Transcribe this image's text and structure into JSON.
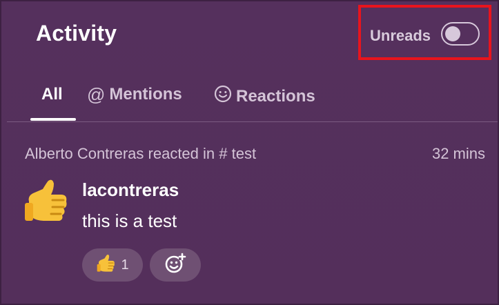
{
  "header": {
    "title": "Activity",
    "unreads_label": "Unreads",
    "unreads_enabled": false
  },
  "tabs": [
    {
      "label": "All",
      "icon": "",
      "active": true
    },
    {
      "label": "Mentions",
      "icon": "at-icon",
      "active": false
    },
    {
      "label": "Reactions",
      "icon": "smiley-icon",
      "active": false
    }
  ],
  "activity": {
    "meta_text": "Alberto Contreras reacted in",
    "channel": "test",
    "time": "32 mins",
    "avatar": "thumbs-up-emoji",
    "username": "lacontreras",
    "message": "this is a test",
    "reactions": [
      {
        "emoji": "thumbs-up",
        "count": "1"
      }
    ],
    "add_reaction_icon": "add-reaction-icon"
  },
  "colors": {
    "background": "#54305b",
    "highlight_box": "#e8141d",
    "muted_text": "#d4c4d7",
    "pill": "#6f5073"
  }
}
